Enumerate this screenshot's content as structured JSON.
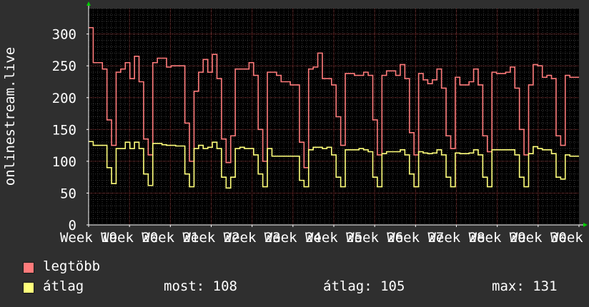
{
  "chart_data": {
    "type": "line",
    "ylabel": "onlinestream.live",
    "ylim": [
      0,
      340
    ],
    "yticks": [
      0,
      50,
      100,
      150,
      200,
      250,
      300
    ],
    "xticks": [
      "Week 19",
      "Week 20",
      "Week 21",
      "Week 22",
      "Week 23",
      "Week 24",
      "Week 25",
      "Week 26",
      "Week 27",
      "Week 28",
      "Week 29",
      "Week 30",
      "Week 31"
    ],
    "grid": true,
    "legend_position": "bottom-left",
    "series": [
      {
        "name": "legtöbb",
        "color": "#ff7b7b",
        "values": [
          310,
          255,
          255,
          245,
          165,
          125,
          240,
          245,
          255,
          230,
          265,
          225,
          135,
          110,
          255,
          262,
          262,
          248,
          250,
          250,
          250,
          160,
          100,
          210,
          240,
          260,
          240,
          268,
          230,
          135,
          98,
          140,
          245,
          245,
          245,
          255,
          235,
          150,
          100,
          240,
          240,
          235,
          225,
          225,
          220,
          220,
          130,
          90,
          245,
          248,
          270,
          230,
          230,
          220,
          170,
          125,
          238,
          238,
          235,
          235,
          240,
          235,
          165,
          110,
          235,
          242,
          242,
          235,
          252,
          230,
          145,
          110,
          238,
          228,
          222,
          228,
          245,
          215,
          140,
          120,
          232,
          220,
          220,
          225,
          245,
          220,
          140,
          115,
          240,
          238,
          238,
          240,
          248,
          215,
          150,
          110,
          220,
          252,
          250,
          232,
          235,
          230,
          140,
          125,
          235,
          232,
          232
        ]
      },
      {
        "name": "átlag",
        "color": "#ffff7b",
        "values": [
          131,
          125,
          125,
          125,
          90,
          65,
          120,
          120,
          130,
          120,
          130,
          120,
          80,
          62,
          128,
          128,
          126,
          125,
          125,
          124,
          124,
          80,
          60,
          120,
          125,
          120,
          122,
          130,
          120,
          75,
          58,
          75,
          120,
          122,
          120,
          120,
          110,
          80,
          60,
          120,
          108,
          108,
          108,
          108,
          108,
          108,
          70,
          60,
          118,
          122,
          122,
          120,
          122,
          110,
          75,
          60,
          118,
          118,
          118,
          120,
          118,
          115,
          75,
          60,
          112,
          115,
          115,
          115,
          118,
          110,
          80,
          60,
          115,
          113,
          112,
          113,
          118,
          110,
          75,
          60,
          113,
          112,
          112,
          113,
          118,
          110,
          75,
          60,
          118,
          118,
          118,
          118,
          118,
          110,
          75,
          60,
          112,
          123,
          120,
          118,
          118,
          112,
          75,
          72,
          110,
          108,
          108
        ]
      }
    ]
  },
  "legend": {
    "max_label": "legtöbb",
    "avg_label": "átlag"
  },
  "stats": {
    "current": "most: 108",
    "average": "átlag: 105",
    "maximum": "max: 131"
  }
}
